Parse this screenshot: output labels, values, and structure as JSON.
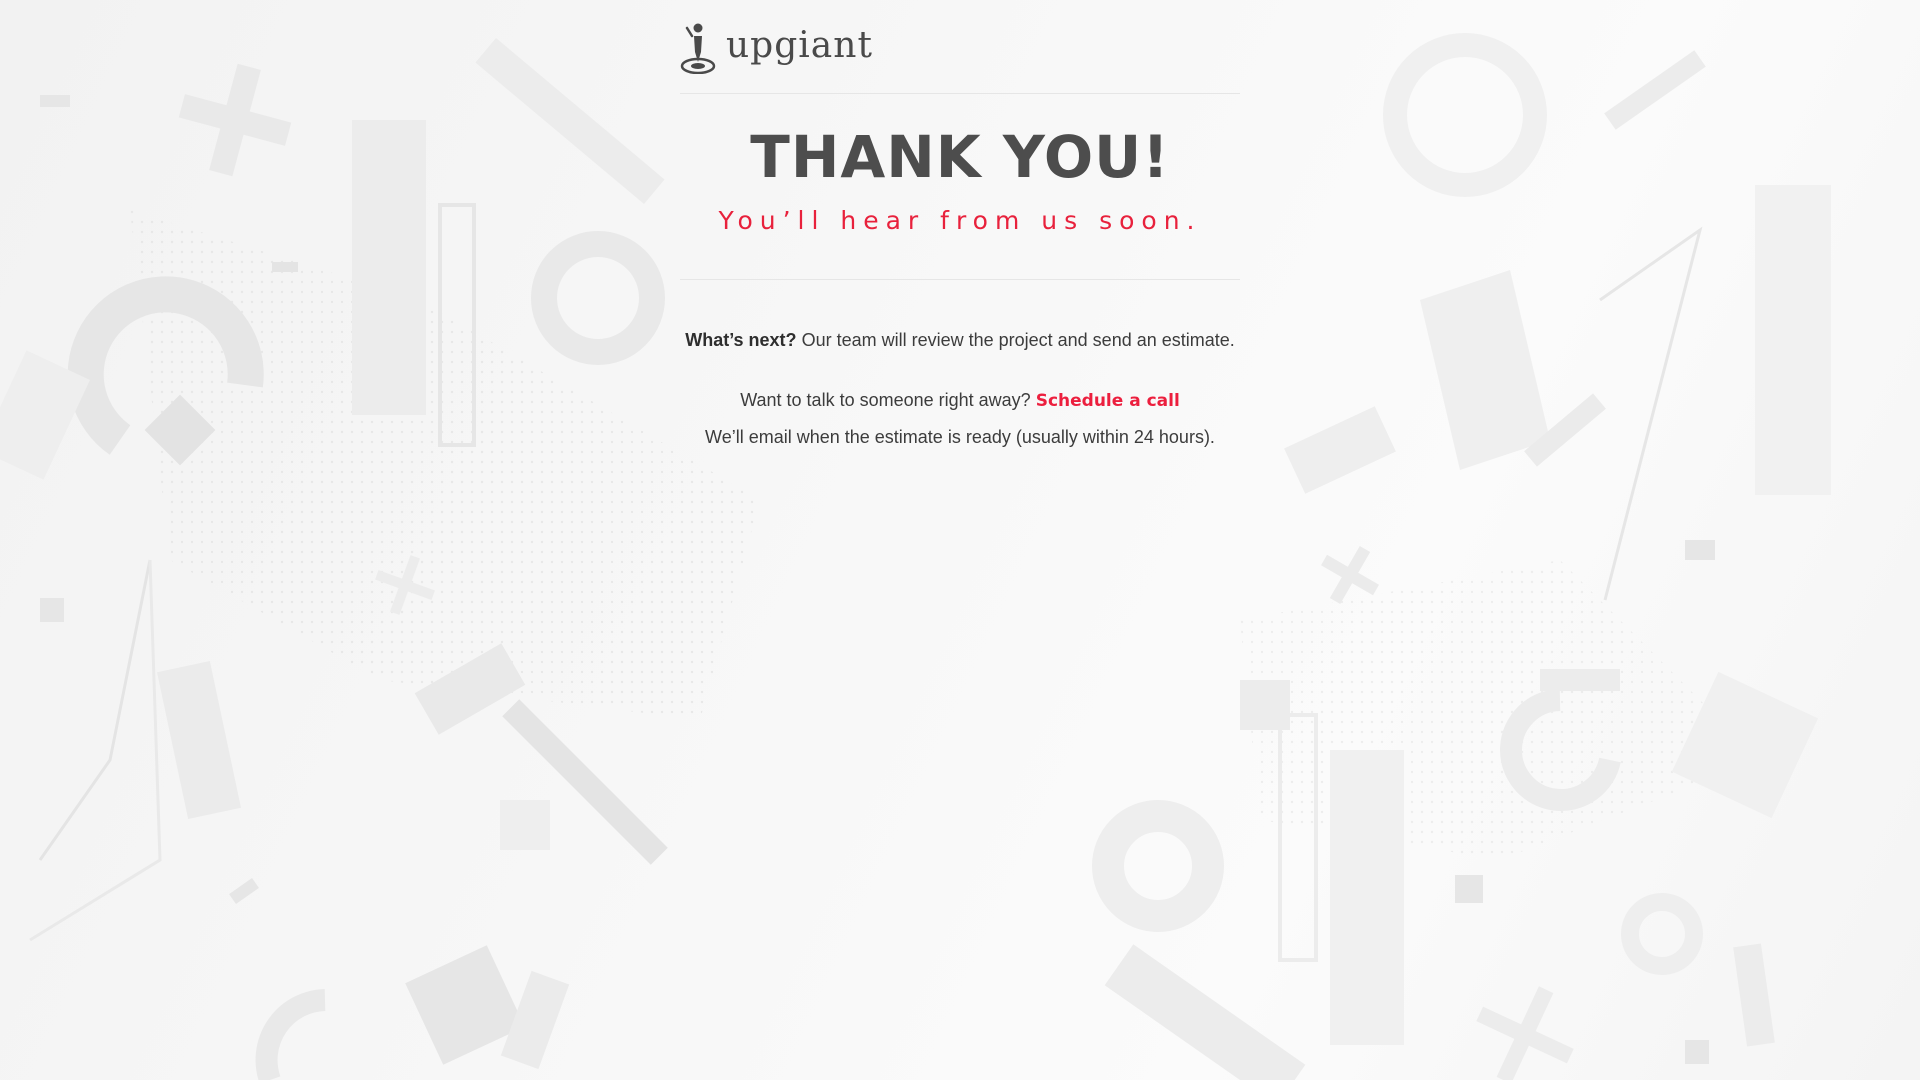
{
  "brand": {
    "logo_text": "upgiant",
    "logo_icon": "person-target-icon",
    "accent_color": "#e8213c"
  },
  "hero": {
    "title": "THANK YOU!",
    "subtitle": "You’ll hear from us soon."
  },
  "next_steps": {
    "label": "What’s next?",
    "text": "Our team will review the project and send an estimate."
  },
  "contact": {
    "prompt": "Want to talk to someone right away?",
    "link_label": "Schedule a call",
    "note": "We’ll email when the estimate is ready (usually within 24 hours)."
  }
}
